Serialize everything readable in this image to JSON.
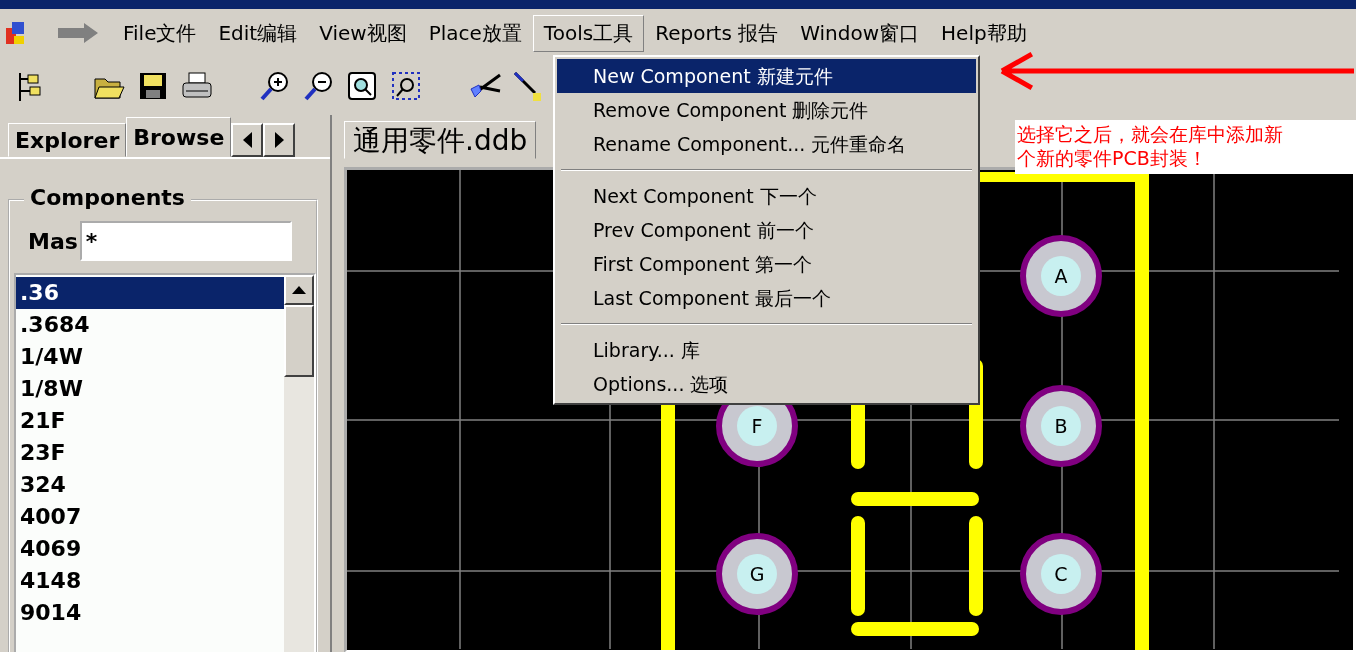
{
  "menu_bar": {
    "items": [
      {
        "label": "File文件",
        "selected": false
      },
      {
        "label": "Edit编辑",
        "selected": false
      },
      {
        "label": "View视图",
        "selected": false
      },
      {
        "label": "Place放置",
        "selected": false
      },
      {
        "label": "Tools工具",
        "selected": true
      },
      {
        "label": "Reports 报告",
        "selected": false
      },
      {
        "label": "Window窗口",
        "selected": false
      },
      {
        "label": "Help帮助",
        "selected": false
      }
    ]
  },
  "left_panel": {
    "tabs": [
      {
        "label": "Explorer",
        "selected": false
      },
      {
        "label": "Browse",
        "selected": true
      }
    ],
    "group_title": "Components",
    "mask": {
      "label": "Mas",
      "value": "*"
    },
    "components": [
      {
        "label": ".36",
        "selected": true
      },
      {
        "label": ".3684",
        "selected": false
      },
      {
        "label": "1/4W",
        "selected": false
      },
      {
        "label": "1/8W",
        "selected": false
      },
      {
        "label": "21F",
        "selected": false
      },
      {
        "label": "23F",
        "selected": false
      },
      {
        "label": "324",
        "selected": false
      },
      {
        "label": "4007",
        "selected": false
      },
      {
        "label": "4069",
        "selected": false
      },
      {
        "label": "4148",
        "selected": false
      },
      {
        "label": "9014",
        "selected": false
      }
    ]
  },
  "document_tab": {
    "label": "通用零件.ddb"
  },
  "canvas": {
    "pads": [
      {
        "label": "A"
      },
      {
        "label": "F"
      },
      {
        "label": "B"
      },
      {
        "label": "G"
      },
      {
        "label": "C"
      }
    ]
  },
  "dropdown_menu": {
    "groups": [
      [
        {
          "label": "New Component 新建元件",
          "selected": true
        },
        {
          "label": "Remove Component 删除元件",
          "selected": false
        },
        {
          "label": "Rename Component... 元件重命名",
          "selected": false
        }
      ],
      [
        {
          "label": "Next Component 下一个",
          "selected": false
        },
        {
          "label": "Prev Component 前一个",
          "selected": false
        },
        {
          "label": "First Component 第一个",
          "selected": false
        },
        {
          "label": "Last Component 最后一个",
          "selected": false
        }
      ],
      [
        {
          "label": "Library... 库",
          "selected": false
        },
        {
          "label": "Options... 选项",
          "selected": false
        }
      ]
    ]
  },
  "annotation": {
    "lines": [
      "选择它之后，就会在库中添加新",
      "个新的零件PCB封装！"
    ]
  }
}
